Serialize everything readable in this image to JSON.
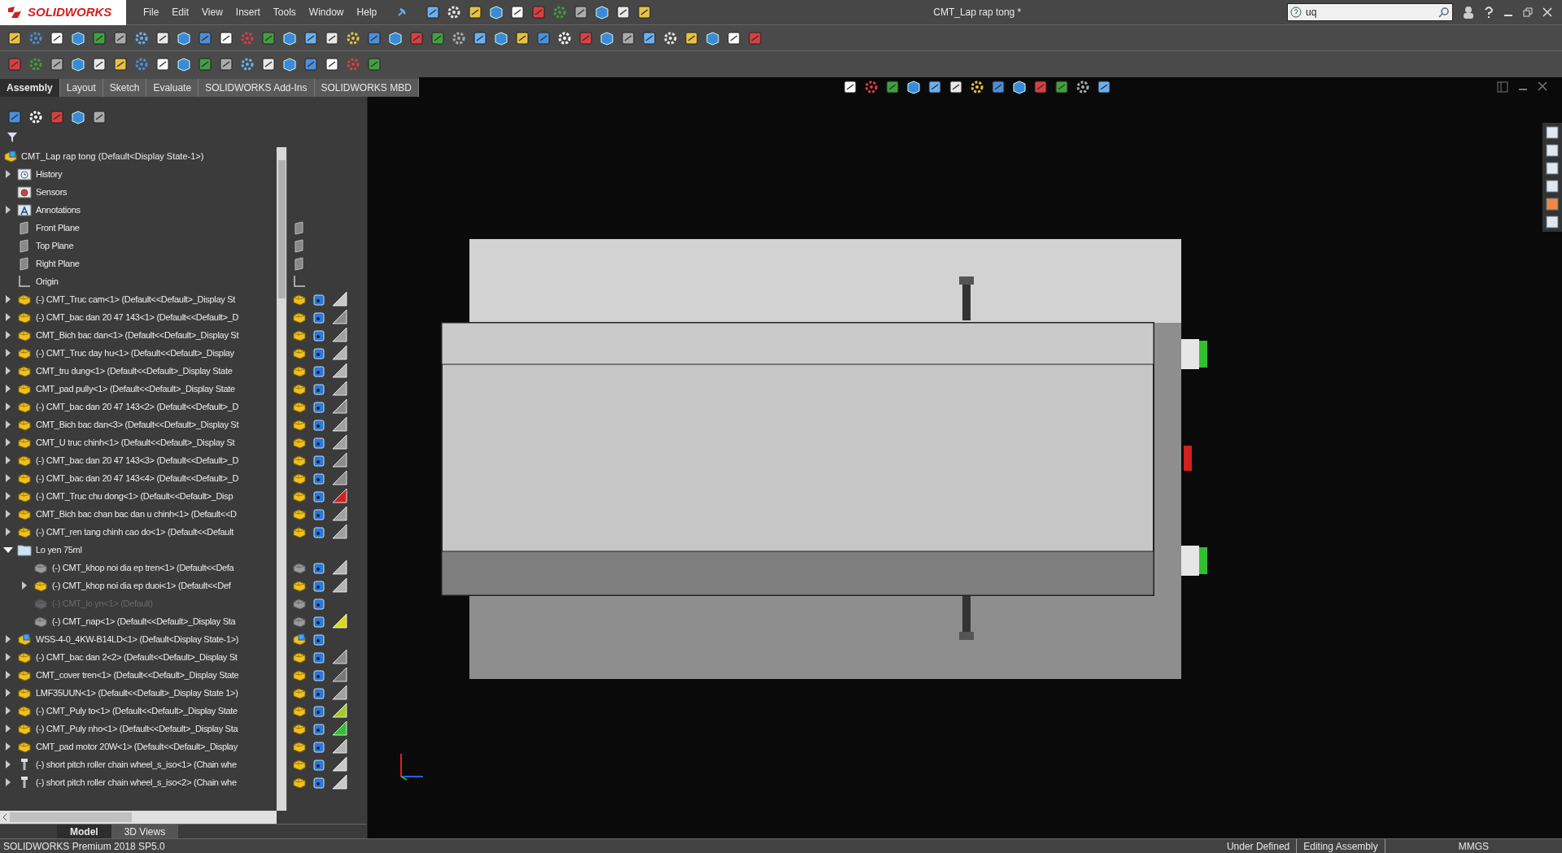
{
  "app": {
    "logo_text": "SOLIDWORKS",
    "menu": [
      "File",
      "Edit",
      "View",
      "Insert",
      "Tools",
      "Window",
      "Help"
    ],
    "document_title": "CMT_Lap rap tong *",
    "search": {
      "value": "uq"
    }
  },
  "command_tabs": [
    {
      "label": "Assembly",
      "selected": true
    },
    {
      "label": "Layout",
      "selected": false
    },
    {
      "label": "Sketch",
      "selected": false
    },
    {
      "label": "Evaluate",
      "selected": false
    },
    {
      "label": "SOLIDWORKS Add-Ins",
      "selected": false
    },
    {
      "label": "SOLIDWORKS MBD",
      "selected": false
    }
  ],
  "tree": {
    "root": "CMT_Lap rap tong  (Default<Display State-1>)",
    "items": [
      {
        "kind": "history",
        "label": "History",
        "expandable": true,
        "expanded": false
      },
      {
        "kind": "sensors",
        "label": "Sensors"
      },
      {
        "kind": "annotations",
        "label": "Annotations",
        "expandable": true,
        "expanded": false
      },
      {
        "kind": "plane",
        "label": "Front Plane"
      },
      {
        "kind": "plane",
        "label": "Top Plane"
      },
      {
        "kind": "plane",
        "label": "Right Plane"
      },
      {
        "kind": "origin",
        "label": "Origin"
      },
      {
        "kind": "part",
        "label": "(-) CMT_Truc cam<1> (Default<<Default>_Display St",
        "expandable": true,
        "expanded": false,
        "hidden": false,
        "suppressed": false,
        "color": "#c8c8c8"
      },
      {
        "kind": "part",
        "label": "(-) CMT_bac dan 20 47 143<1> (Default<<Default>_D",
        "expandable": true,
        "expanded": false,
        "hidden": false,
        "suppressed": false,
        "color": "#8c8c8c"
      },
      {
        "kind": "part",
        "label": "CMT_Bich bac dan<1> (Default<<Default>_Display St",
        "expandable": true,
        "expanded": false,
        "hidden": false,
        "suppressed": false,
        "color": "#a0a0a0"
      },
      {
        "kind": "part",
        "label": "(-) CMT_Truc day hu<1> (Default<<Default>_Display",
        "expandable": true,
        "expanded": false,
        "hidden": false,
        "suppressed": false,
        "color": "#b4b4b4"
      },
      {
        "kind": "part",
        "label": "CMT_tru dung<1> (Default<<Default>_Display State",
        "expandable": true,
        "expanded": false,
        "hidden": false,
        "suppressed": false,
        "color": "#b4b4b4"
      },
      {
        "kind": "part",
        "label": "CMT_pad pully<1> (Default<<Default>_Display State",
        "expandable": true,
        "expanded": false,
        "hidden": false,
        "suppressed": false,
        "color": "#a0a0a0"
      },
      {
        "kind": "part",
        "label": "(-) CMT_bac dan 20 47 143<2> (Default<<Default>_D",
        "expandable": true,
        "expanded": false,
        "hidden": false,
        "suppressed": false,
        "color": "#8c8c8c"
      },
      {
        "kind": "part",
        "label": "CMT_Bich bac dan<3> (Default<<Default>_Display St",
        "expandable": true,
        "expanded": false,
        "hidden": false,
        "suppressed": false,
        "color": "#a0a0a0"
      },
      {
        "kind": "part",
        "label": "CMT_U truc chinh<1> (Default<<Default>_Display St",
        "expandable": true,
        "expanded": false,
        "hidden": false,
        "suppressed": false,
        "color": "#a0a0a0"
      },
      {
        "kind": "part",
        "label": "(-) CMT_bac dan 20 47 143<3> (Default<<Default>_D",
        "expandable": true,
        "expanded": false,
        "hidden": false,
        "suppressed": false,
        "color": "#8c8c8c"
      },
      {
        "kind": "part",
        "label": "(-) CMT_bac dan 20 47 143<4> (Default<<Default>_D",
        "expandable": true,
        "expanded": false,
        "hidden": false,
        "suppressed": false,
        "color": "#8c8c8c"
      },
      {
        "kind": "part",
        "label": "(-) CMT_Truc chu dong<1> (Default<<Default>_Disp",
        "expandable": true,
        "expanded": false,
        "hidden": false,
        "suppressed": false,
        "color": "#d42020"
      },
      {
        "kind": "part",
        "label": "CMT_Bich bac chan bac dan u chinh<1> (Default<<D",
        "expandable": true,
        "expanded": false,
        "hidden": false,
        "suppressed": false,
        "color": "#a0a0a0"
      },
      {
        "kind": "part",
        "label": "(-) CMT_ren tang chinh cao do<1> (Default<<Default",
        "expandable": true,
        "expanded": false,
        "hidden": false,
        "suppressed": false,
        "color": "#a0a0a0"
      },
      {
        "kind": "folder",
        "label": "Lo yen 75ml",
        "expandable": true,
        "expanded": true,
        "children": [
          {
            "kind": "part",
            "label": "(-) CMT_khop noi dia ep tren<1> (Default<<Defa",
            "hidden": true,
            "suppressed": false,
            "color": "#b4b4b4"
          },
          {
            "kind": "part",
            "label": "(-) CMT_khop noi dia ep duoi<1> (Default<<Def",
            "expandable": true,
            "expanded": false,
            "hidden": false,
            "suppressed": false,
            "color": "#b4b4b4"
          },
          {
            "kind": "part",
            "label": "(-) CMT_lo yn<1> (Default)",
            "hidden": true,
            "suppressed": true
          },
          {
            "kind": "part",
            "label": "(-) CMT_nap<1> (Default<<Default>_Display Sta",
            "hidden": true,
            "suppressed": false,
            "color": "#d8d820"
          }
        ]
      },
      {
        "kind": "assembly",
        "label": "WSS-4-0_4KW-B14LD<1> (Default<Display State-1>)",
        "expandable": true,
        "expanded": false,
        "hidden": false,
        "suppressed": false
      },
      {
        "kind": "part",
        "label": "(-) CMT_bac dan 2<2> (Default<<Default>_Display St",
        "expandable": true,
        "expanded": false,
        "hidden": false,
        "suppressed": false,
        "color": "#8c8c8c"
      },
      {
        "kind": "part",
        "label": "CMT_cover tren<1> (Default<<Default>_Display State",
        "expandable": true,
        "expanded": false,
        "hidden": false,
        "suppressed": false,
        "color": "#787878"
      },
      {
        "kind": "part",
        "label": "LMF35UUN<1> (Default<<Default>_Display State 1>)",
        "expandable": true,
        "expanded": false,
        "hidden": false,
        "suppressed": false,
        "color": "#a0a0a0"
      },
      {
        "kind": "part",
        "label": "(-) CMT_Puly to<1> (Default<<Default>_Display State",
        "expandable": true,
        "expanded": false,
        "hidden": false,
        "suppressed": false,
        "color": "#a8c830"
      },
      {
        "kind": "part",
        "label": "(-) CMT_Puly nho<1> (Default<<Default>_Display Sta",
        "expandable": true,
        "expanded": false,
        "hidden": false,
        "suppressed": false,
        "color": "#30c030"
      },
      {
        "kind": "part",
        "label": "CMT_pad motor 20W<1> (Default<<Default>_Display",
        "expandable": true,
        "expanded": false,
        "hidden": false,
        "suppressed": false,
        "color": "#b4b4b4"
      },
      {
        "kind": "toolbox",
        "label": "(-) short pitch roller chain wheel_s_iso<1> (Chain whe",
        "expandable": true,
        "expanded": false,
        "hidden": false,
        "suppressed": false,
        "color": "#c8c8c8"
      },
      {
        "kind": "toolbox",
        "label": "(-) short pitch roller chain wheel_s_iso<2> (Chain whe",
        "expandable": true,
        "expanded": false,
        "hidden": false,
        "suppressed": false,
        "color": "#c8c8c8"
      }
    ]
  },
  "bottom_tabs": [
    {
      "label": "Model",
      "selected": true
    },
    {
      "label": "3D Views",
      "selected": false
    }
  ],
  "status_bar": {
    "product": "SOLIDWORKS Premium 2018 SP5.0",
    "state": "Under Defined",
    "mode": "Editing Assembly",
    "units": "MMGS"
  }
}
